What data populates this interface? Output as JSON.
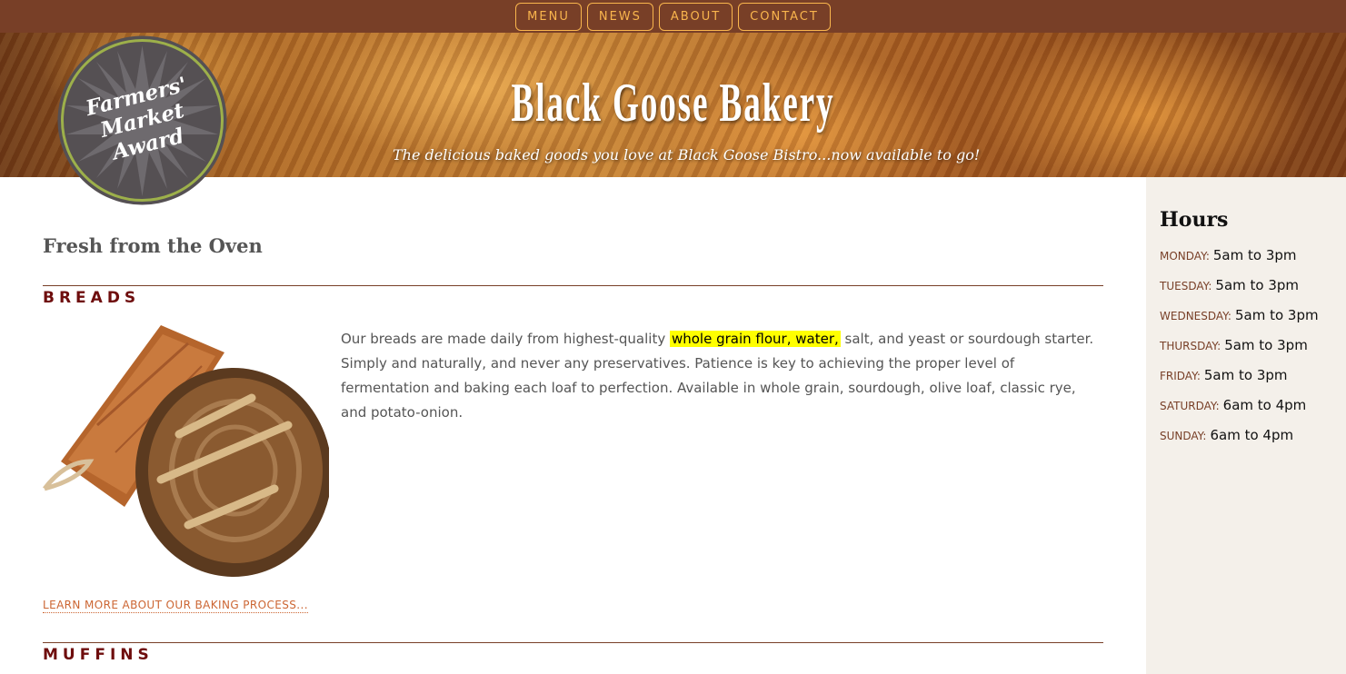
{
  "nav": {
    "items": [
      {
        "label": "MENU"
      },
      {
        "label": "NEWS"
      },
      {
        "label": "ABOUT"
      },
      {
        "label": "CONTACT"
      }
    ]
  },
  "hero": {
    "title": "Black Goose Bakery",
    "tagline": "The delicious baked goods you love at Black Goose Bistro...now available to go!"
  },
  "award": {
    "line1": "Farmers'",
    "line2": "Market",
    "line3": "Award"
  },
  "main": {
    "heading": "Fresh from the Oven",
    "breads": {
      "title": "BREADS",
      "text_before": "Our breads are made daily from highest-quality",
      "highlight": "whole grain flour, water,",
      "text_after": "salt, and yeast or sourdough starter. Simply and naturally, and never any preservatives. Patience is key to achieving the proper level of fermentation and baking each loaf to perfection. Available in whole grain, sourdough, olive loaf, classic rye, and potato-onion.",
      "link": "LEARN MORE ABOUT OUR BAKING PROCESS..."
    },
    "muffins": {
      "title": "MUFFINS"
    }
  },
  "sidebar": {
    "title": "Hours",
    "hours": [
      {
        "day": "MONDAY:",
        "time": "5am to 3pm"
      },
      {
        "day": "TUESDAY:",
        "time": "5am to 3pm"
      },
      {
        "day": "WEDNESDAY:",
        "time": "5am to 3pm"
      },
      {
        "day": "THURSDAY:",
        "time": "5am to 3pm"
      },
      {
        "day": "FRIDAY:",
        "time": "5am to 3pm"
      },
      {
        "day": "SATURDAY:",
        "time": "6am to 4pm"
      },
      {
        "day": "SUNDAY:",
        "time": "6am to 4pm"
      }
    ]
  },
  "colors": {
    "nav_bg": "#783f27",
    "nav_accent": "#f9b54d",
    "section_title": "#6e0d0d",
    "highlight": "#ffff00",
    "link": "#cc6633",
    "sidebar_bg": "#f4f0ea"
  }
}
